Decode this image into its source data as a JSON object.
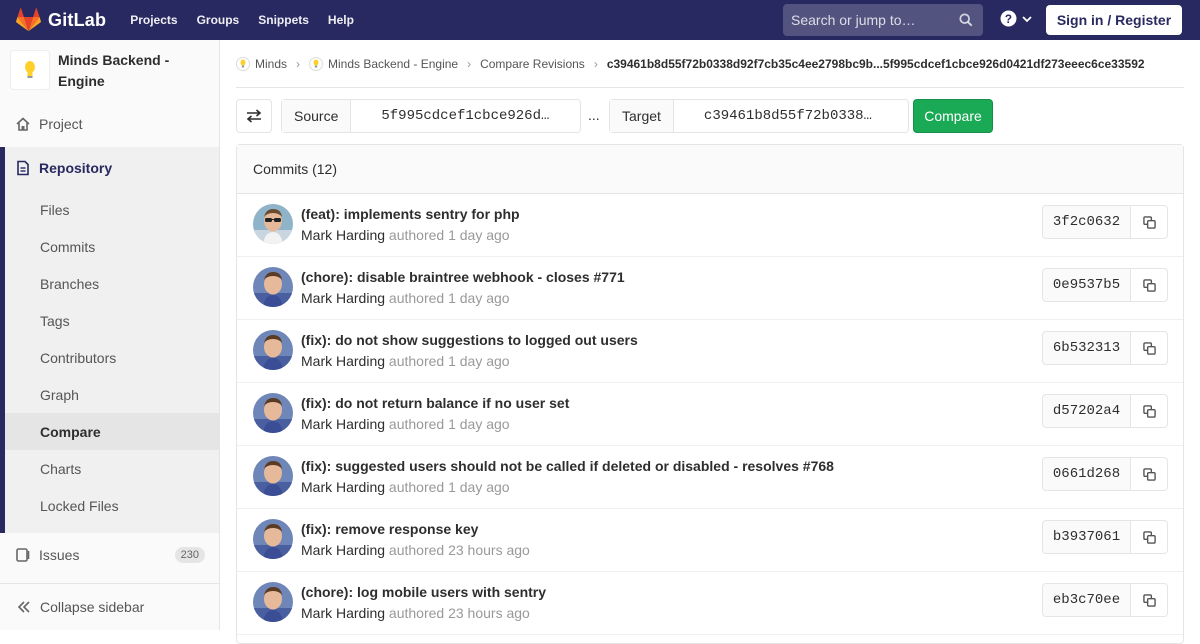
{
  "navbar": {
    "brand": "GitLab",
    "links": [
      "Projects",
      "Groups",
      "Snippets",
      "Help"
    ],
    "search_placeholder": "Search or jump to…",
    "signin_label": "Sign in / Register"
  },
  "sidebar": {
    "project_name": "Minds Backend - Engine",
    "project_label": "Project",
    "repository_label": "Repository",
    "repo_items": [
      "Files",
      "Commits",
      "Branches",
      "Tags",
      "Contributors",
      "Graph",
      "Compare",
      "Charts",
      "Locked Files"
    ],
    "active_item": "Compare",
    "issues_label": "Issues",
    "issues_count": "230",
    "collapse_label": "Collapse sidebar"
  },
  "breadcrumbs": {
    "items": [
      "Minds",
      "Minds Backend - Engine",
      "Compare Revisions"
    ],
    "current": "c39461b8d55f72b0338d92f7cb35c4ee2798bc9b...5f995cdcef1cbce926d0421df273eeec6ce33592"
  },
  "compare": {
    "source_label": "Source",
    "source_value": "5f995cdcef1cbce926d…",
    "separator": "...",
    "target_label": "Target",
    "target_value": "c39461b8d55f72b0338…",
    "button_label": "Compare"
  },
  "commits": {
    "header": "Commits (12)",
    "items": [
      {
        "title": "(feat): implements sentry for php",
        "author": "Mark Harding",
        "authored": "authored 1 day ago",
        "sha": "3f2c0632"
      },
      {
        "title": "(chore): disable braintree webhook - closes #771",
        "author": "Mark Harding",
        "authored": "authored 1 day ago",
        "sha": "0e9537b5"
      },
      {
        "title": "(fix): do not show suggestions to logged out users",
        "author": "Mark Harding",
        "authored": "authored 1 day ago",
        "sha": "6b532313"
      },
      {
        "title": "(fix): do not return balance if no user set",
        "author": "Mark Harding",
        "authored": "authored 1 day ago",
        "sha": "d57202a4"
      },
      {
        "title": "(fix): suggested users should not be called if deleted or disabled - resolves #768",
        "author": "Mark Harding",
        "authored": "authored 1 day ago",
        "sha": "0661d268"
      },
      {
        "title": "(fix): remove response key",
        "author": "Mark Harding",
        "authored": "authored 23 hours ago",
        "sha": "b3937061"
      },
      {
        "title": "(chore): log mobile users with sentry",
        "author": "Mark Harding",
        "authored": "authored 23 hours ago",
        "sha": "eb3c70ee"
      }
    ]
  },
  "colors": {
    "navbar": "#292961",
    "compare_button": "#1aaa55"
  }
}
